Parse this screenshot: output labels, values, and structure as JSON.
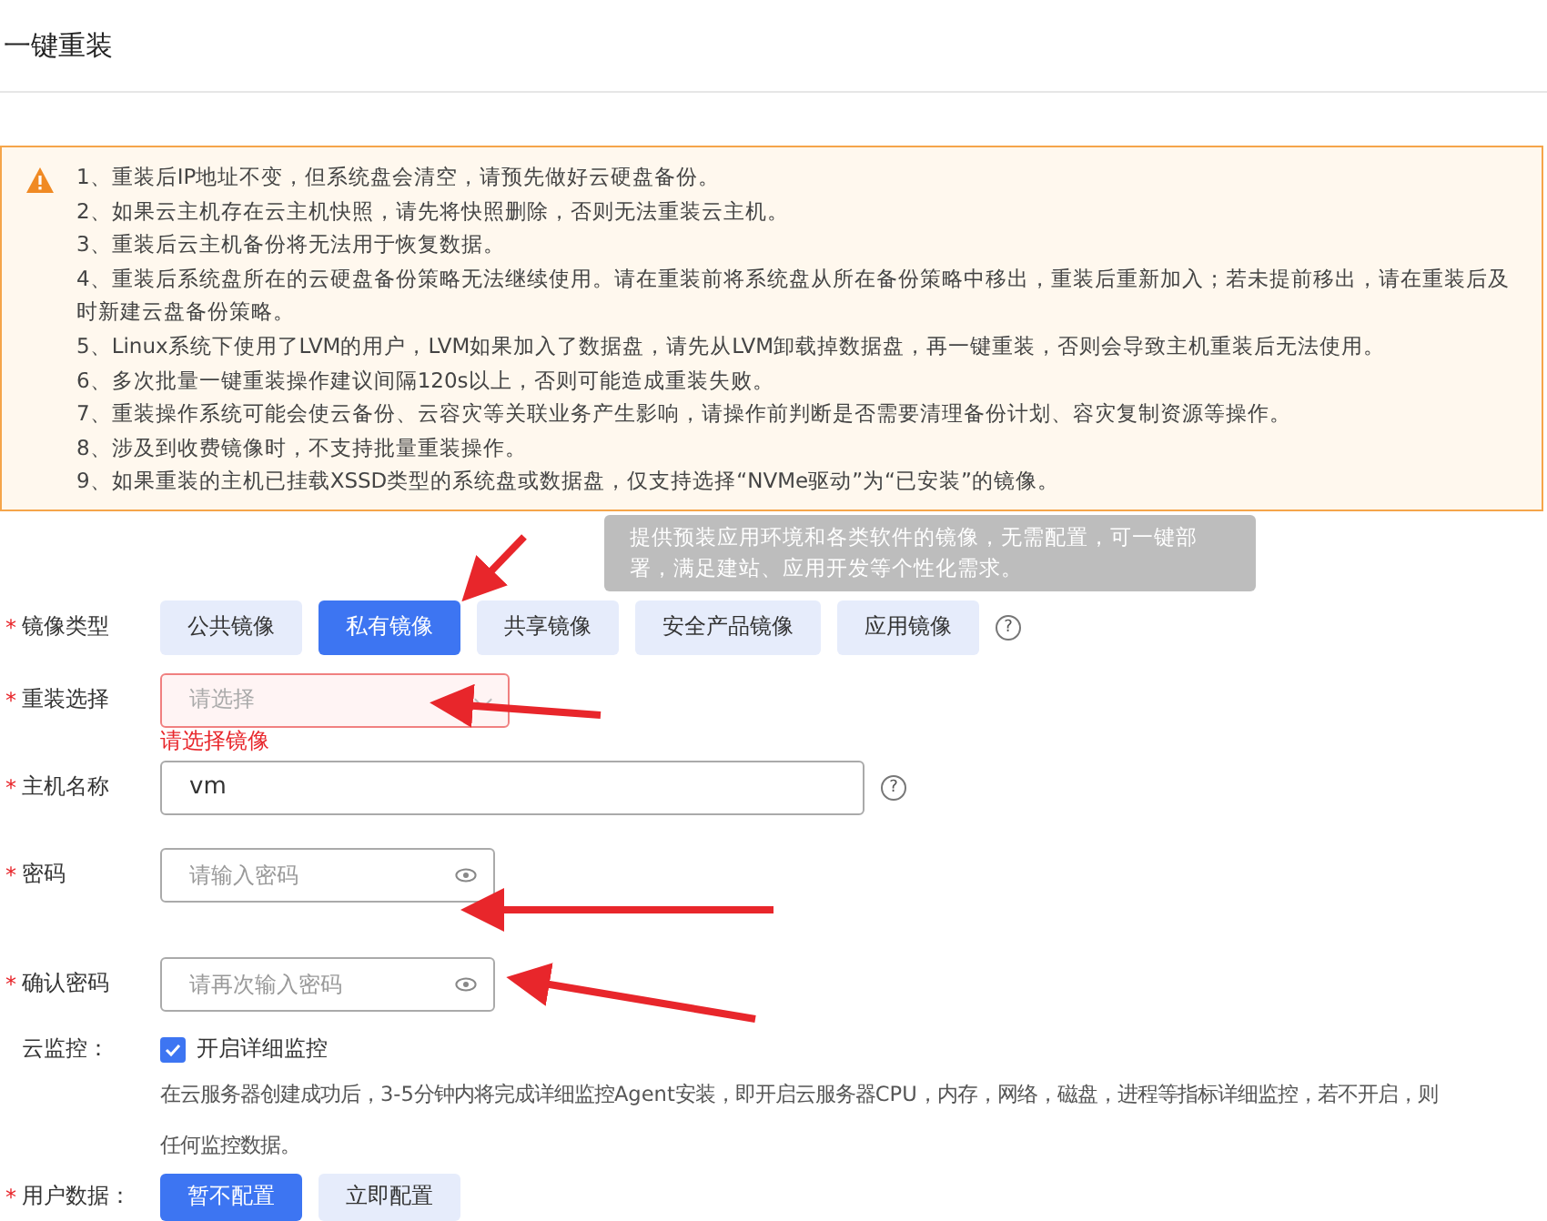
{
  "title": "一键重装",
  "required_mark": "*",
  "notice": {
    "lines": [
      "1、重装后IP地址不变，但系统盘会清空，请预先做好云硬盘备份。",
      "2、如果云主机存在云主机快照，请先将快照删除，否则无法重装云主机。",
      "3、重装后云主机备份将无法用于恢复数据。",
      "4、重装后系统盘所在的云硬盘备份策略无法继续使用。请在重装前将系统盘从所在备份策略中移出，重装后重新加入；若未提前移出，请在重装后及时新建云盘备份策略。",
      "5、Linux系统下使用了LVM的用户，LVM如果加入了数据盘，请先从LVM卸载掉数据盘，再一键重装，否则会导致主机重装后无法使用。",
      "6、多次批量一键重装操作建议间隔120s以上，否则可能造成重装失败。",
      "7、重装操作系统可能会使云备份、云容灾等关联业务产生影响，请操作前判断是否需要清理备份计划、容灾复制资源等操作。",
      "8、涉及到收费镜像时，不支持批量重装操作。",
      "9、如果重装的主机已挂载XSSD类型的系统盘或数据盘，仅支持选择“NVMe驱动”为“已安装”的镜像。"
    ]
  },
  "tooltip": "提供预装应用环境和各类软件的镜像，无需配置，可一键部署，满足建站、应用开发等个性化需求。",
  "image_type": {
    "label": "镜像类型",
    "required": true,
    "help": "?",
    "options": [
      {
        "label": "公共镜像",
        "selected": false
      },
      {
        "label": "私有镜像",
        "selected": true
      },
      {
        "label": "共享镜像",
        "selected": false
      },
      {
        "label": "安全产品镜像",
        "selected": false
      },
      {
        "label": "应用镜像",
        "selected": false
      }
    ]
  },
  "reinstall_select": {
    "label": "重装选择",
    "required": true,
    "placeholder": "请选择",
    "error": "请选择镜像"
  },
  "hostname": {
    "label": "主机名称",
    "required": true,
    "value": "vm",
    "help": "?"
  },
  "password": {
    "label": "密码",
    "required": true,
    "placeholder": "请输入密码"
  },
  "confirm_password": {
    "label": "确认密码",
    "required": true,
    "placeholder": "请再次输入密码"
  },
  "monitoring": {
    "label": "云监控：",
    "checkbox_label": "开启详细监控",
    "checked": true,
    "description": "在云服务器创建成功后，3-5分钟内将完成详细监控Agent安装，即开启云服务器CPU，内存，网络，磁盘，进程等指标详细监控，若不开启，则",
    "description_2": "任何监控数据。"
  },
  "user_data": {
    "label": "用户数据：",
    "required": true,
    "options": [
      {
        "label": "暂不配置",
        "selected": true
      },
      {
        "label": "立即配置",
        "selected": false
      }
    ]
  }
}
